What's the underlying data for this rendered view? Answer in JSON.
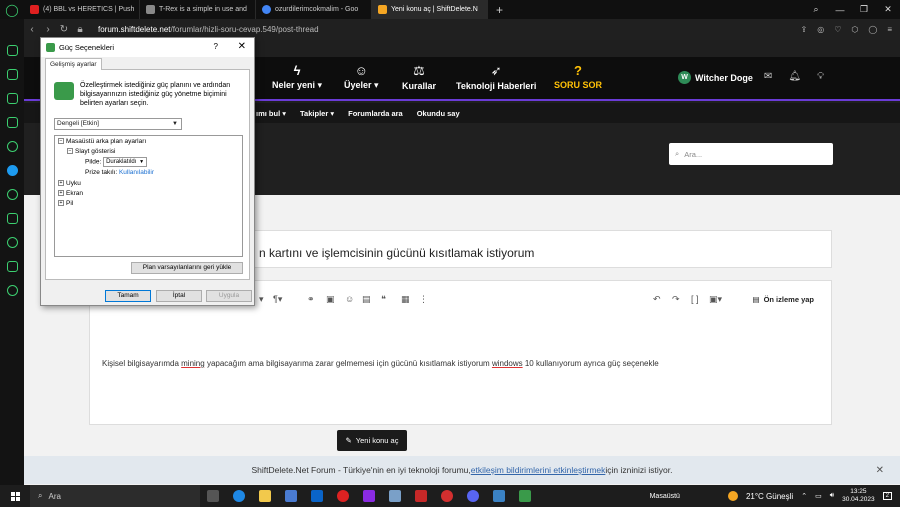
{
  "browser": {
    "tabs": [
      {
        "label": "(4) BBL vs HERETICS | Push",
        "color": "#e02020"
      },
      {
        "label": "T-Rex is a simple in use and",
        "color": "#888888"
      },
      {
        "label": "ozurdilerimcokmalim - Goo",
        "color": "#4285f4"
      },
      {
        "label": "Yeni konu aç | ShiftDelete.N",
        "color": "#f5a623",
        "active": true
      }
    ],
    "url_host": "forum.shiftdelete.net",
    "url_path": "/forumlar/hizli-soru-cevap.549/post-thread"
  },
  "site": {
    "nav": {
      "neler_yeni": "Neler yeni",
      "uyeler": "Üyeler",
      "kurallar": "Kurallar",
      "teknoloji": "Teknoloji Haberleri",
      "soru_sor": "SORU SOR"
    },
    "user": {
      "initial": "W",
      "name": "Witcher Doge"
    },
    "subnav": {
      "item1": "ımı bul",
      "item2": "Takipler",
      "item3": "Forumlarda ara",
      "item4": "Okundu say"
    },
    "search_placeholder": "Ara...",
    "thread_title": "n kartını ve işlemcisinin gücünü kısıtlamak istiyorum",
    "preview_label": "Ön izleme yap",
    "body": {
      "p1": "Kişisel bilgisayarımda ",
      "w1": "mining",
      "p2": " yapacağım ama bilgisayarıma zarar gelmemesi için gücünü kısıtlamak istiyorum ",
      "w2": "windows",
      "p3": " 10 kullanıyorum ayrıca güç seçenekle"
    },
    "new_thread_label": "Yeni konu aç"
  },
  "notice": {
    "pre": "ShiftDelete.Net Forum - Türkiye'nin en iyi teknoloji forumu, ",
    "link": "etkileşim bildirimlerini etkinleştirmek",
    "post": " için izninizi istiyor."
  },
  "dialog": {
    "title": "Güç Seçenekleri",
    "help": "?",
    "tab": "Gelişmiş ayarlar",
    "description": "Özelleştirmek istediğiniz güç planını ve ardından bilgisayarınızın istediğiniz güç yönetme biçimini belirten ayarları seçin.",
    "plan": "Dengeli [Etkin]",
    "tree": {
      "desktop_bg": "Masaüstü arka plan ayarları",
      "slideshow": "Slayt gösterisi",
      "on_battery": "Pilde:",
      "battery_value": "Duraklatıldı",
      "plugged_in": "Prize takılı:",
      "plugged_value": "Kullanılabilir",
      "sleep": "Uyku",
      "display": "Ekran",
      "battery": "Pil"
    },
    "restore_button": "Plan varsayılanlarını geri yükle",
    "ok": "Tamam",
    "cancel": "İptal",
    "apply": "Uygula"
  },
  "taskbar": {
    "search": "Ara",
    "desktop_label": "Masaüstü",
    "weather": "21°C  Güneşli",
    "time": "13:25",
    "date": "30.04.2023",
    "notif_count": "2"
  }
}
